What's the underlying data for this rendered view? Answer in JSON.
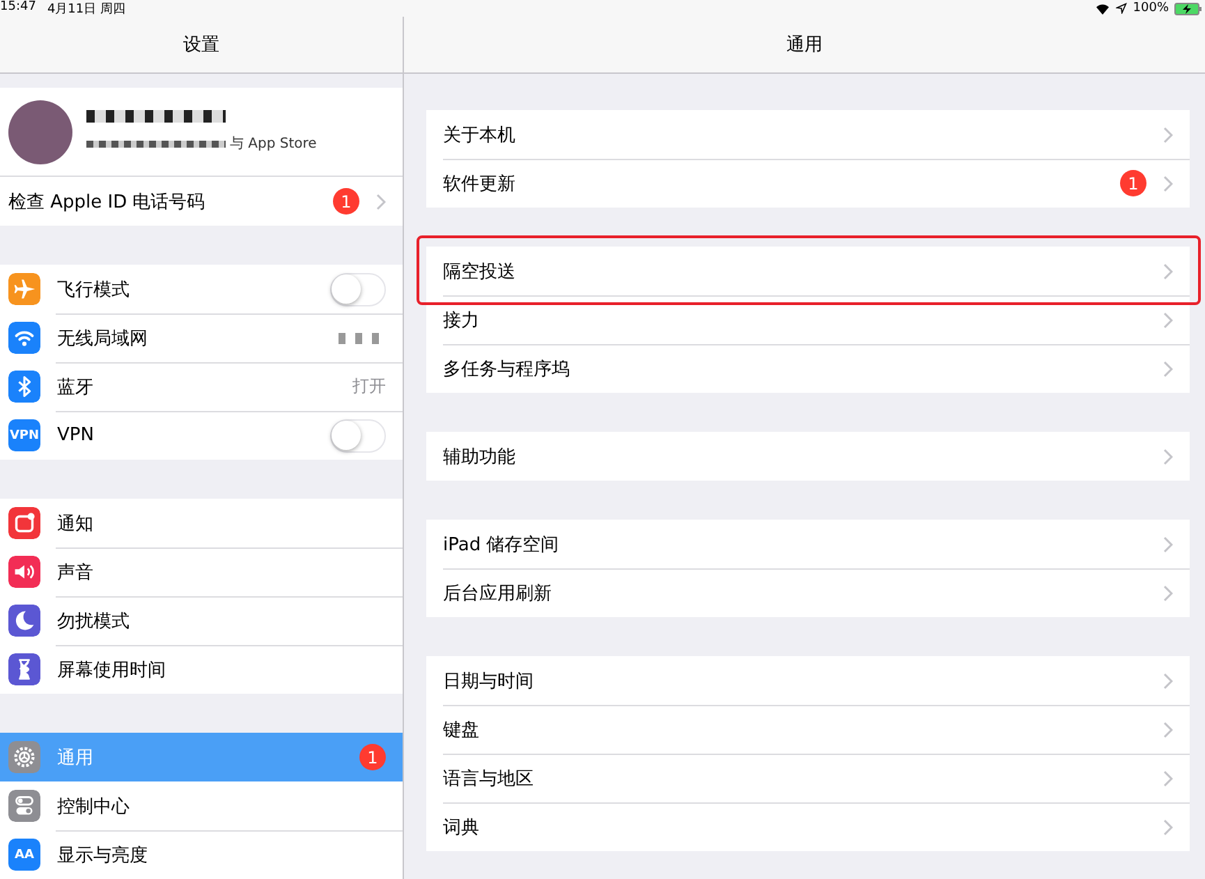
{
  "status_bar": {
    "time": "15:47",
    "date": "4月11日 周四",
    "battery": "100%"
  },
  "sidebar": {
    "title": "设置",
    "profile": {
      "subtitle": "与 App Store"
    },
    "groups": [
      [
        {
          "kind": "chevron",
          "label": "检查 Apple ID 电话号码",
          "badge": "1",
          "selected": false
        }
      ],
      [
        {
          "kind": "toggle",
          "label": "飞行模式",
          "color": "#f7931e",
          "on": false,
          "selected": false
        },
        {
          "kind": "redacted",
          "label": "无线局域网",
          "color": "#1a82fb",
          "selected": false
        },
        {
          "kind": "value",
          "label": "蓝牙",
          "color": "#1a82fb",
          "value": "打开",
          "selected": false
        },
        {
          "kind": "toggle",
          "label": "VPN",
          "color": "#1a82fb",
          "icon_text": "VPN",
          "on": false,
          "selected": false
        }
      ],
      [
        {
          "kind": "plain",
          "label": "通知",
          "color": "#f2353a",
          "selected": false
        },
        {
          "kind": "plain",
          "label": "声音",
          "color": "#f22d55",
          "selected": false
        },
        {
          "kind": "plain",
          "label": "勿扰模式",
          "color": "#5b57d3",
          "selected": false
        },
        {
          "kind": "plain",
          "label": "屏幕使用时间",
          "color": "#5b57d3",
          "selected": false
        }
      ],
      [
        {
          "kind": "plain",
          "label": "通用",
          "color": "#8e8e93",
          "badge": "1",
          "selected": true
        },
        {
          "kind": "plain",
          "label": "控制中心",
          "color": "#8e8e93",
          "selected": false
        },
        {
          "kind": "plain",
          "label": "显示与亮度",
          "color": "#1a82fb",
          "icon_text": "AA",
          "selected": false
        }
      ]
    ]
  },
  "detail": {
    "title": "通用",
    "groups": [
      [
        {
          "label": "关于本机",
          "highlighted": false
        },
        {
          "label": "软件更新",
          "badge": "1",
          "highlighted": false
        }
      ],
      [
        {
          "label": "隔空投送",
          "highlighted": true
        },
        {
          "label": "接力",
          "highlighted": false
        },
        {
          "label": "多任务与程序坞",
          "highlighted": false
        }
      ],
      [
        {
          "label": "辅助功能",
          "highlighted": false
        }
      ],
      [
        {
          "label": "iPad 储存空间",
          "highlighted": false
        },
        {
          "label": "后台应用刷新",
          "highlighted": false
        }
      ],
      [
        {
          "label": "日期与时间",
          "highlighted": false
        },
        {
          "label": "键盘",
          "highlighted": false
        },
        {
          "label": "语言与地区",
          "highlighted": false
        },
        {
          "label": "词典",
          "highlighted": false
        }
      ]
    ]
  }
}
